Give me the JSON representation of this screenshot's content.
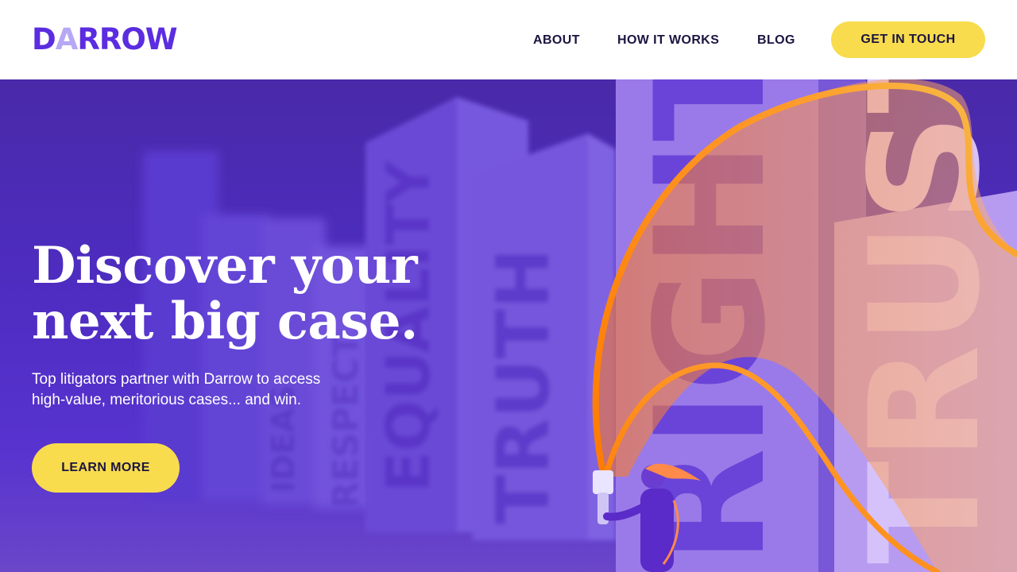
{
  "header": {
    "logo_text_pre": "D",
    "logo_text_accent": "A",
    "logo_text_post": "RROW",
    "nav": [
      {
        "label": "ABOUT"
      },
      {
        "label": "HOW IT WORKS"
      },
      {
        "label": "BLOG"
      }
    ],
    "cta_label": "GET IN TOUCH"
  },
  "hero": {
    "headline_line1": "Discover your",
    "headline_line2": "next big case.",
    "subtext_line1": "Top litigators partner with Darrow to access",
    "subtext_line2": "high-value, meritorious cases... and win.",
    "button_label": "LEARN MORE",
    "illustration_words": [
      "EQUALITY",
      "TRUTH",
      "RIGHTS",
      "TRUST",
      "RESPECT",
      "IDEAS"
    ]
  },
  "colors": {
    "brand_purple": "#5b2ce0",
    "hero_bg": "#4d2cc0",
    "accent_yellow": "#f8dc4d",
    "light_orange": "#ff8a1f",
    "text_dark": "#1b1540"
  }
}
